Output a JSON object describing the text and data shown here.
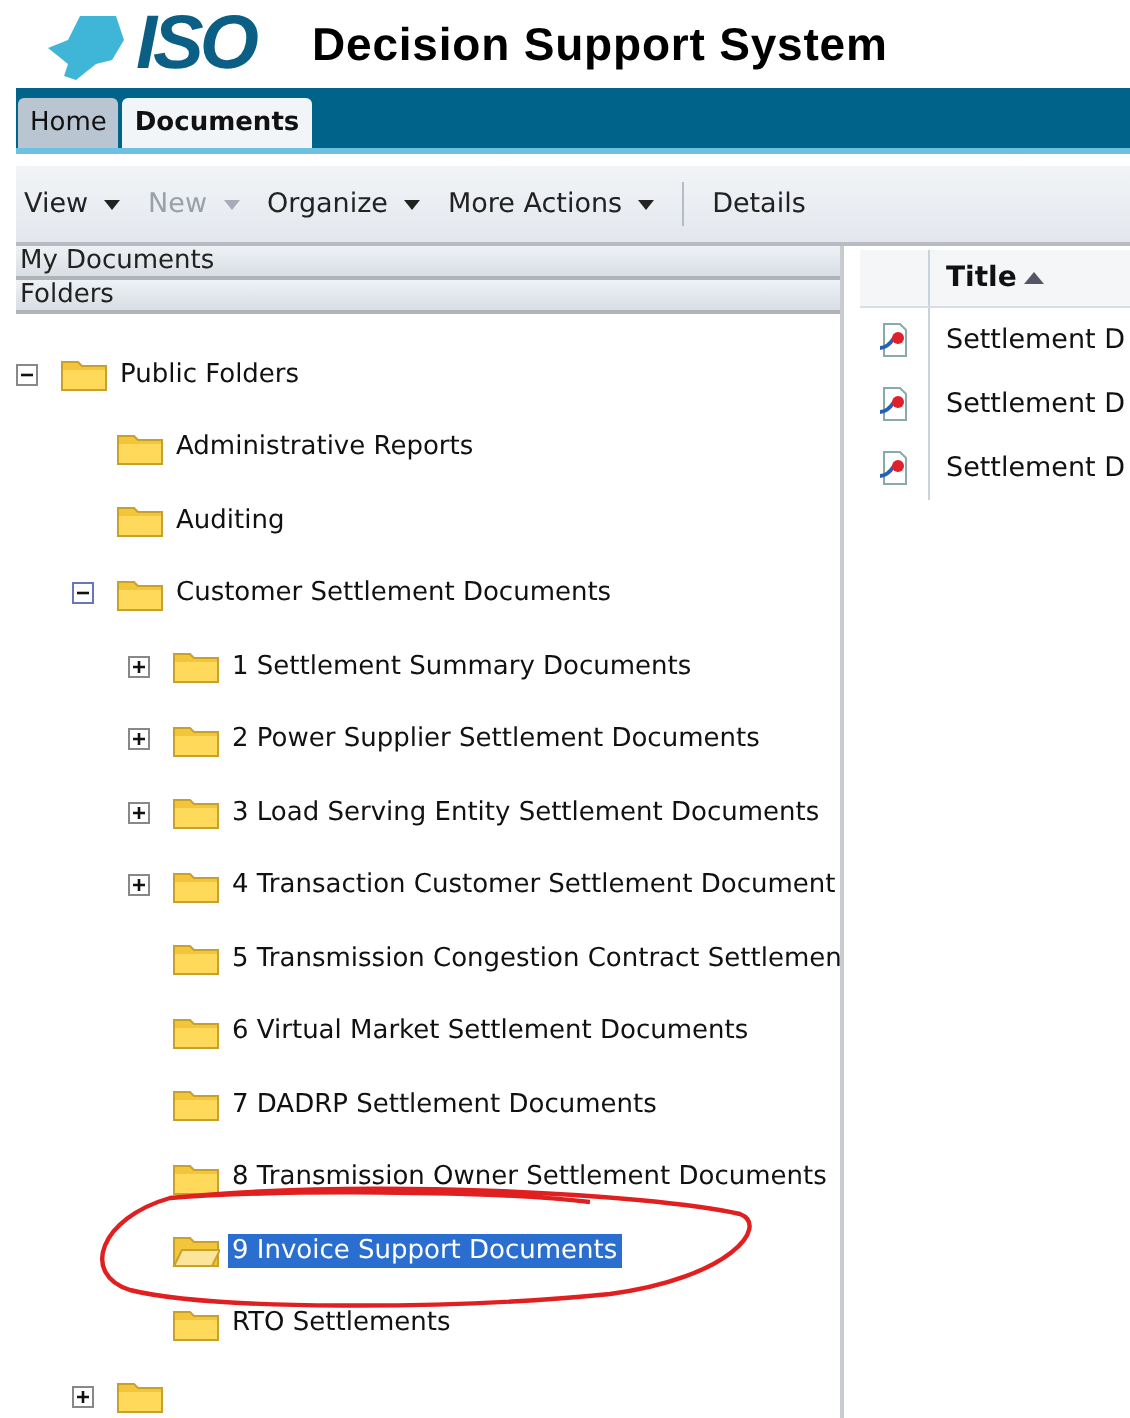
{
  "header": {
    "logo_text": "ISO",
    "title": "Decision Support System"
  },
  "tabs": [
    {
      "label": "Home",
      "selected": false
    },
    {
      "label": "Documents",
      "selected": true
    }
  ],
  "toolbar": [
    {
      "label": "View",
      "kind": "menu",
      "disabled": false
    },
    {
      "label": "New",
      "kind": "menu",
      "disabled": true
    },
    {
      "label": "Organize",
      "kind": "menu",
      "disabled": false
    },
    {
      "label": "More Actions",
      "kind": "menu",
      "disabled": false
    },
    {
      "label": "Details",
      "kind": "button",
      "disabled": false
    }
  ],
  "sidebar": {
    "sections": [
      "My Documents",
      "Folders"
    ],
    "tree": [
      {
        "label": "Public Folders",
        "kind": "branch",
        "expanded": true,
        "selected": false,
        "children": [
          {
            "label": "Administrative Reports",
            "kind": "leaf",
            "selected": false
          },
          {
            "label": "Auditing",
            "kind": "leaf",
            "selected": false
          },
          {
            "label": "Customer Settlement Documents",
            "kind": "branch",
            "expanded": true,
            "selected": false,
            "children": [
              {
                "label": "1 Settlement Summary Documents",
                "kind": "branch",
                "expanded": false,
                "selected": false
              },
              {
                "label": "2 Power Supplier Settlement Documents",
                "kind": "branch",
                "expanded": false,
                "selected": false
              },
              {
                "label": "3 Load Serving Entity Settlement Documents",
                "kind": "branch",
                "expanded": false,
                "selected": false
              },
              {
                "label": "4 Transaction Customer Settlement Document",
                "kind": "branch",
                "expanded": false,
                "selected": false
              },
              {
                "label": "5 Transmission Congestion Contract Settlemen",
                "kind": "leaf",
                "selected": false
              },
              {
                "label": "6 Virtual Market Settlement Documents",
                "kind": "leaf",
                "selected": false
              },
              {
                "label": "7 DADRP Settlement Documents",
                "kind": "leaf",
                "selected": false
              },
              {
                "label": "8 Transmission Owner Settlement Documents",
                "kind": "leaf",
                "selected": false
              },
              {
                "label": "9 Invoice Support Documents",
                "kind": "leaf",
                "selected": true
              },
              {
                "label": "RTO Settlements",
                "kind": "leaf",
                "selected": false
              }
            ]
          }
        ]
      }
    ]
  },
  "table": {
    "columns": [
      "Title"
    ],
    "sort_ascending": true,
    "rows": [
      {
        "title": "Settlement D"
      },
      {
        "title": "Settlement D"
      },
      {
        "title": "Settlement D"
      }
    ]
  }
}
